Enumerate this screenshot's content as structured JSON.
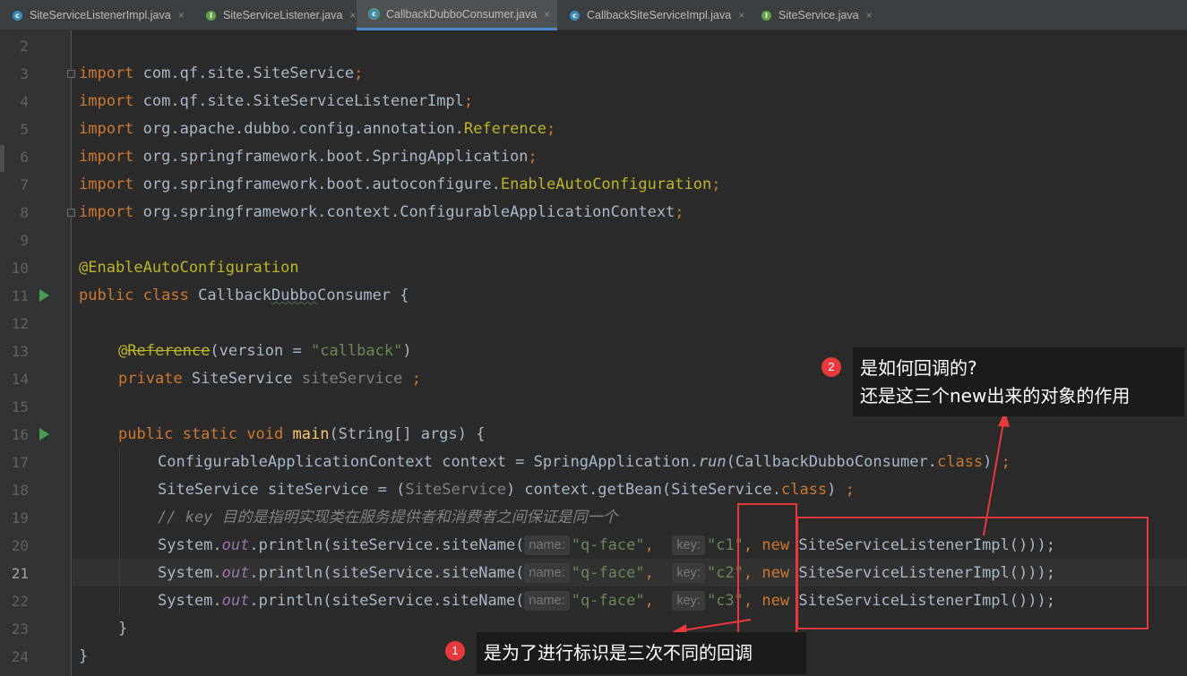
{
  "tabs": [
    {
      "label": "SiteServiceListenerImpl.java",
      "icon": "class-icon",
      "active": false
    },
    {
      "label": "SiteServiceListener.java",
      "icon": "interface-icon",
      "active": false
    },
    {
      "label": "CallbackDubboConsumer.java",
      "icon": "runnable-class-icon",
      "active": true
    },
    {
      "label": "CallbackSiteServiceImpl.java",
      "icon": "class-icon",
      "active": false
    },
    {
      "label": "SiteService.java",
      "icon": "interface-icon",
      "active": false
    }
  ],
  "tab_close_glyph": "×",
  "line_numbers": [
    "2",
    "3",
    "4",
    "5",
    "6",
    "7",
    "8",
    "9",
    "10",
    "11",
    "12",
    "13",
    "14",
    "15",
    "16",
    "17",
    "18",
    "19",
    "20",
    "21",
    "22",
    "23",
    "24"
  ],
  "current_line": "21",
  "code": {
    "import_kw": "import",
    "l3_path": "com.qf.site.SiteService",
    "l4_path": "com.qf.site.SiteServiceListenerImpl",
    "l5_path": "org.apache.dubbo.config.annotation.",
    "l5_cls": "Reference",
    "l6_path": "org.springframework.boot.SpringApplication",
    "l7_path": "org.springframework.boot.autoconfigure.",
    "l7_cls": "EnableAutoConfiguration",
    "l8_path": "org.springframework.context.ConfigurableApplicationContext",
    "semi": ";",
    "l10_ann": "@EnableAutoConfiguration",
    "l11_kw": "public class",
    "l11_name_a": "Callback",
    "l11_name_b": "Dubbo",
    "l11_name_c": "Consumer {",
    "l13_at": "@",
    "l13_ann": "Reference",
    "l13_open": "(version = ",
    "l13_str": "\"callback\"",
    "l13_close": ")",
    "l14_kw": "private",
    "l14_type": "SiteService",
    "l14_field": "siteService",
    "l14_semi": " ;",
    "l16_kw": "public static void",
    "l16_method": "main",
    "l16_rest": "(String[] args) {",
    "l17_a": "ConfigurableApplicationContext context = SpringApplication.",
    "l17_run": "run",
    "l17_b": "(CallbackDubboConsumer.",
    "l17_class": "class",
    "l17_c": ") ",
    "l18_a": "SiteService siteService = (",
    "l18_cast": "SiteService",
    "l18_b": ") context.getBean(SiteService.",
    "l18_class": "class",
    "l18_c": ") ",
    "l19_comment": "// key 目的是指明实现类在服务提供者和消费者之间保证是同一个",
    "println_a": "System.",
    "println_out": "out",
    "println_b": ".println(siteService.siteName(",
    "hint_name": "name:",
    "arg_name": "\"q-face\"",
    "comma": ",",
    "hint_key": "key:",
    "keys": [
      "\"c1\"",
      "\"c2\"",
      "\"c3\""
    ],
    "new_kw": "new",
    "new_rest": "SiteServiceListenerImpl()));",
    "close_brace": "}"
  },
  "callouts": {
    "one_number": "1",
    "one_text": "是为了进行标识是三次不同的回调",
    "two_number": "2",
    "two_line1": "是如何回调的?",
    "two_line2": "还是这三个new出来的对象的作用"
  }
}
